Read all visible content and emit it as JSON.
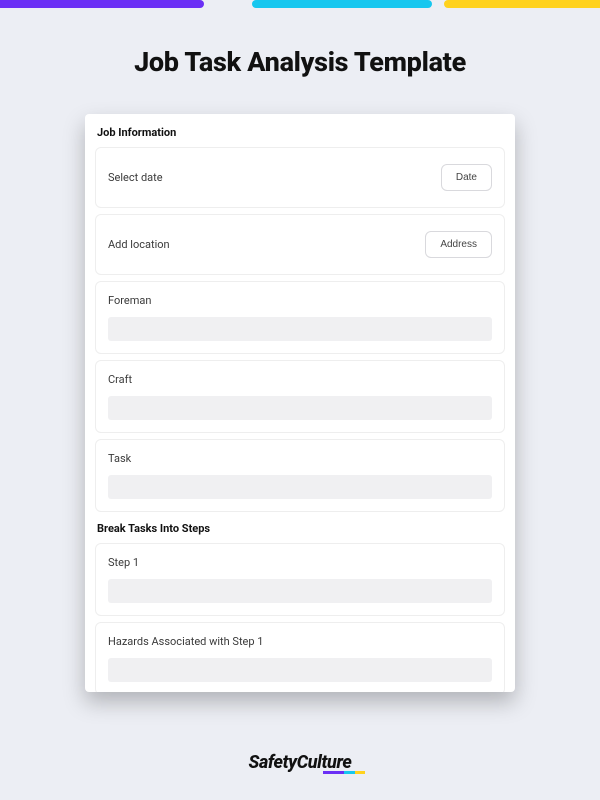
{
  "header": {
    "title": "Job Task Analysis Template"
  },
  "brand": {
    "name": "SafetyCulture"
  },
  "form": {
    "section1": {
      "title": "Job Information",
      "date_row": {
        "label": "Select date",
        "button": "Date"
      },
      "location_row": {
        "label": "Add location",
        "button": "Address"
      },
      "foreman": {
        "label": "Foreman"
      },
      "craft": {
        "label": "Craft"
      },
      "task": {
        "label": "Task"
      }
    },
    "section2": {
      "title": "Break Tasks Into Steps",
      "step1": {
        "label": "Step 1"
      },
      "hazards1": {
        "label": "Hazards Associated with Step 1"
      }
    }
  }
}
